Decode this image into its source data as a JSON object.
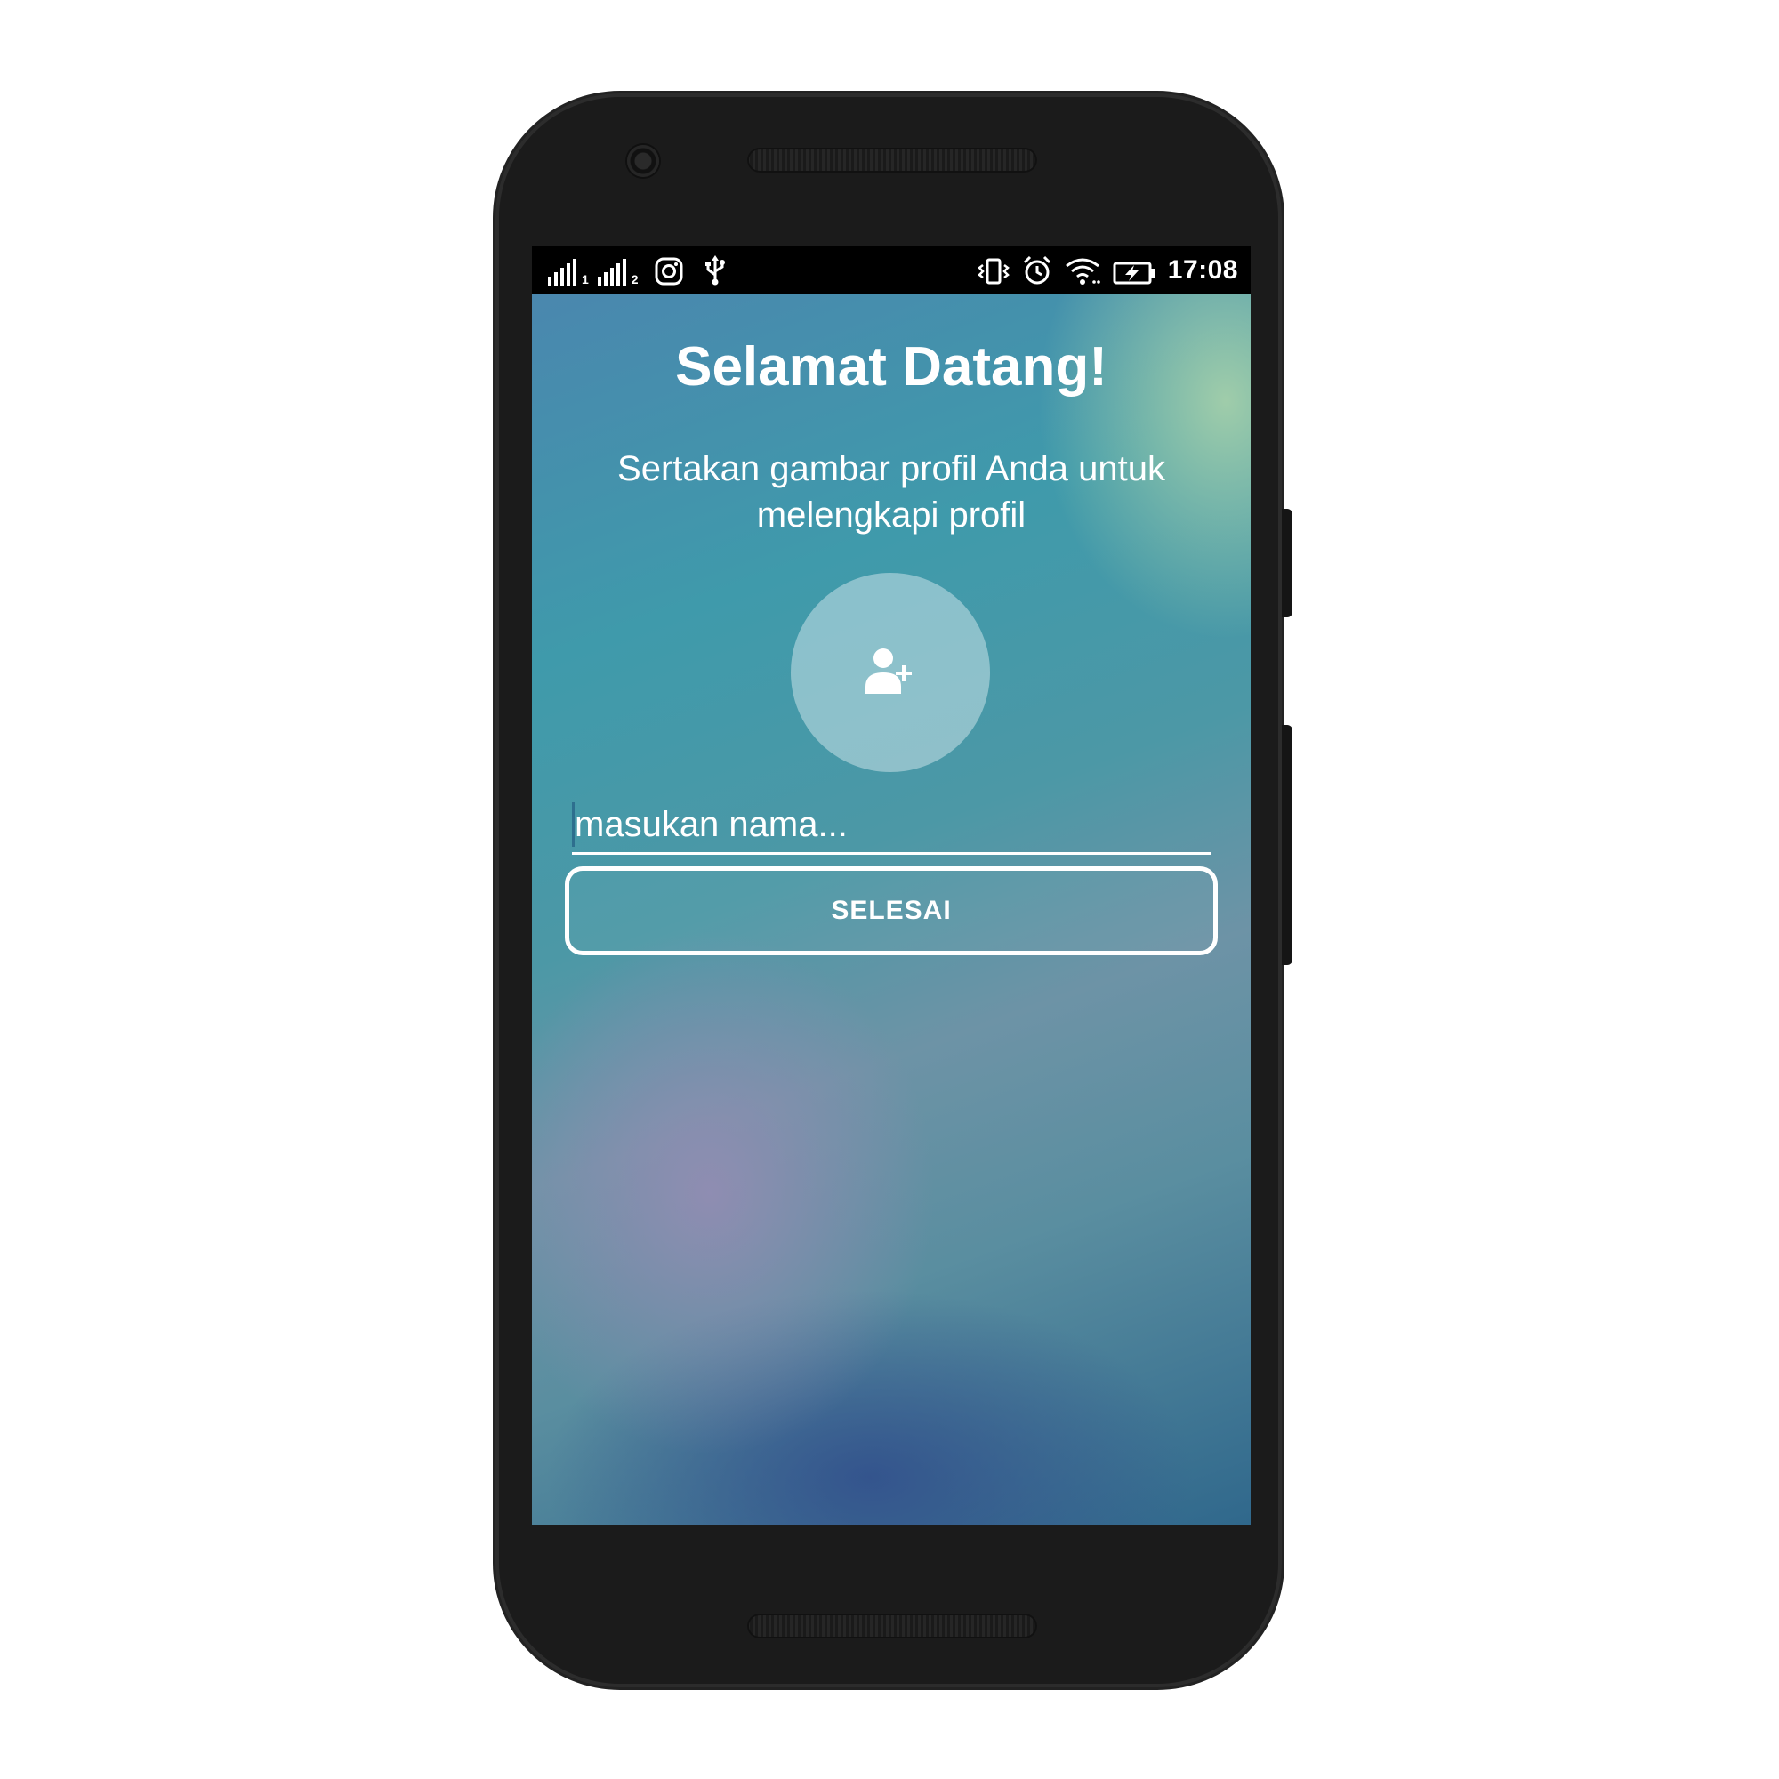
{
  "status_bar": {
    "sim1_label": "1",
    "sim2_label": "2",
    "time": "17:08",
    "icons_left": [
      "signal-icon",
      "signal-icon",
      "instagram-icon",
      "usb-icon"
    ],
    "icons_right": [
      "vibrate-icon",
      "alarm-icon",
      "wifi-icon",
      "battery-charging-icon"
    ]
  },
  "welcome": {
    "title": "Selamat Datang!",
    "subtitle": "Sertakan gambar profil Anda untuk melengkapi profil"
  },
  "profile": {
    "avatar_icon": "add-user-icon"
  },
  "form": {
    "name_placeholder": "masukan nama...",
    "name_value": "",
    "done_label": "SELESAI"
  },
  "colors": {
    "text": "#ffffff",
    "status_bar_bg": "#000000",
    "phone_body": "#1b1b1b",
    "caret": "#2e6f8e"
  }
}
